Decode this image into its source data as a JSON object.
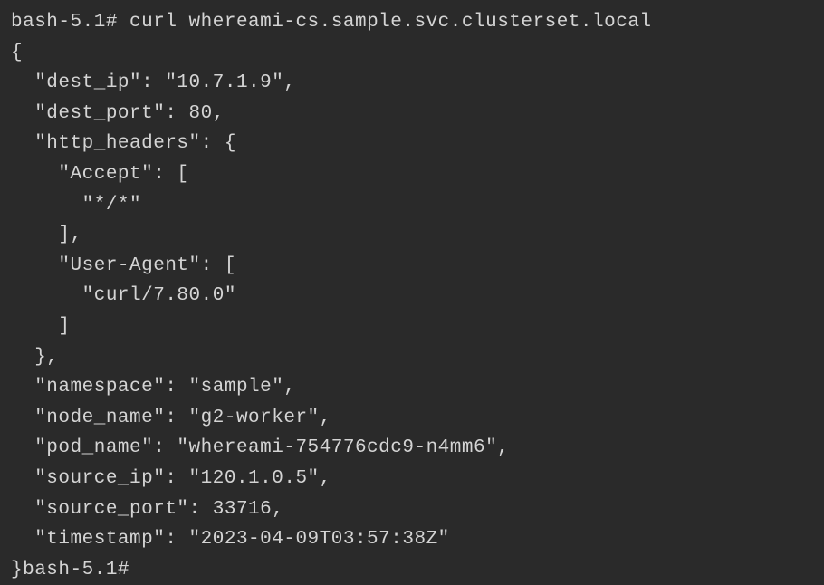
{
  "prompt1": "bash-5.1# ",
  "command": "curl whereami-cs.sample.svc.clusterset.local",
  "line_open_brace": "{",
  "line_dest_ip": "  \"dest_ip\": \"10.7.1.9\",",
  "line_dest_port": "  \"dest_port\": 80,",
  "line_http_headers": "  \"http_headers\": {",
  "line_accept_key": "    \"Accept\": [",
  "line_accept_val": "      \"*/*\"",
  "line_accept_close": "    ],",
  "line_ua_key": "    \"User-Agent\": [",
  "line_ua_val": "      \"curl/7.80.0\"",
  "line_ua_close": "    ]",
  "line_headers_close": "  },",
  "line_namespace": "  \"namespace\": \"sample\",",
  "line_node_name": "  \"node_name\": \"g2-worker\",",
  "line_pod_name": "  \"pod_name\": \"whereami-754776cdc9-n4mm6\",",
  "line_source_ip": "  \"source_ip\": \"120.1.0.5\",",
  "line_source_port": "  \"source_port\": 33716,",
  "line_timestamp": "  \"timestamp\": \"2023-04-09T03:57:38Z\"",
  "line_close_and_prompt": "}bash-5.1# "
}
